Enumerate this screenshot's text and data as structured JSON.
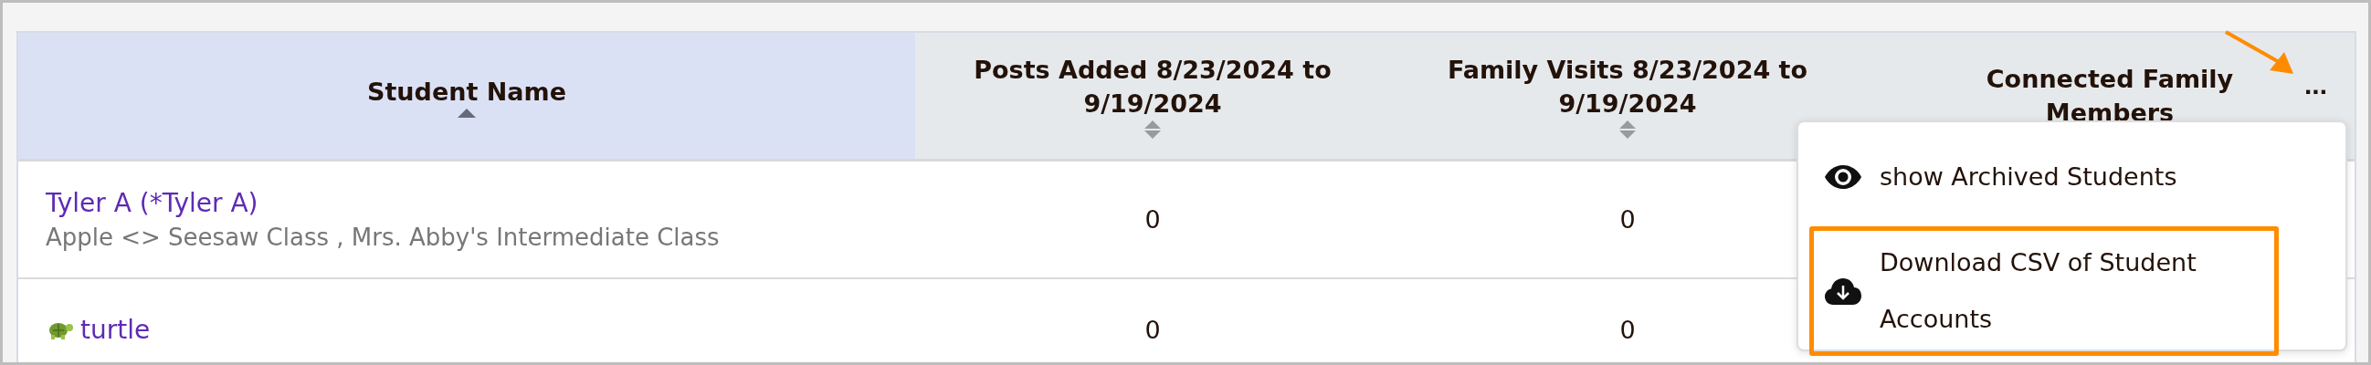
{
  "table": {
    "columns": [
      {
        "label": "Student Name",
        "sorted": true
      },
      {
        "label": "Posts Added 8/23/2024 to 9/19/2024",
        "sorted": false
      },
      {
        "label": "Family Visits 8/23/2024 to 9/19/2024",
        "sorted": false
      },
      {
        "label": "Connected Family Members"
      }
    ],
    "rows": [
      {
        "name": "Tyler A (*Tyler A)",
        "classes": "Apple <> Seesaw Class , Mrs. Abby's Intermediate Class",
        "posts": "0",
        "visits": "0"
      },
      {
        "name": "turtle",
        "kind": "avatar",
        "posts": "0",
        "visits": "0"
      }
    ]
  },
  "more_button": {
    "label": "..."
  },
  "menu": {
    "items": [
      {
        "label": "show Archived Students",
        "highlighted": false
      },
      {
        "label": "Download CSV of Student Accounts",
        "highlighted": true
      }
    ]
  },
  "annotation": {
    "kind": "arrow"
  }
}
